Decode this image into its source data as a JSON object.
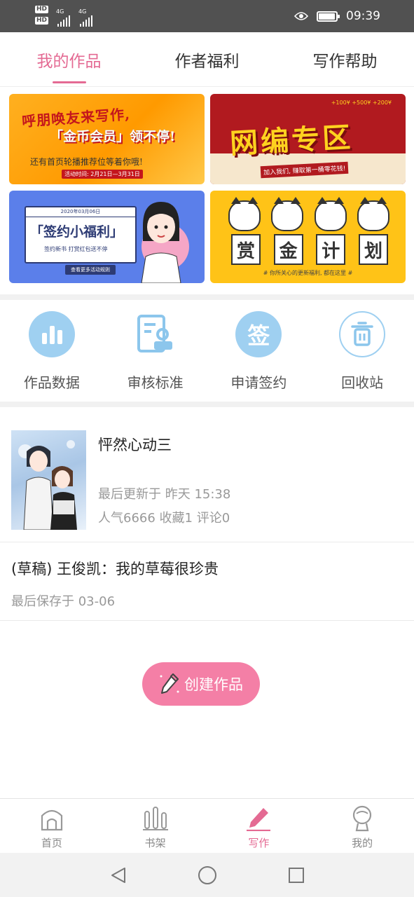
{
  "status_bar": {
    "time": "09:39",
    "network_1": "4G",
    "network_2": "4G",
    "hd": "HD",
    "battery_level": 0.95
  },
  "tabs": [
    {
      "label": "我的作品",
      "active": true
    },
    {
      "label": "作者福利",
      "active": false
    },
    {
      "label": "写作帮助",
      "active": false
    }
  ],
  "banners": {
    "b1": {
      "title": "呼朋唤友来写作,",
      "highlight": "「金币会员」领不停!",
      "sub": "还有首页轮播推荐位等着你哦!",
      "date": "活动时间: 2月21日—3月31日"
    },
    "b2": {
      "title": "网编专区",
      "sub": "加入我们, 赚取第一桶零花钱!",
      "coins": "+100¥  +500¥  +200¥"
    },
    "b3": {
      "window_date": "2020年03月06日",
      "title": "「签约小福利」",
      "sub": "签约新书  打赏红包送不停",
      "button": "查看更多活动规则"
    },
    "b4": {
      "chars": [
        "赏",
        "金",
        "计",
        "划"
      ],
      "sub": "# 你所关心的更新福利, 都在这里 #"
    }
  },
  "actions": [
    {
      "label": "作品数据",
      "icon": "bar-chart-icon",
      "color": "#9fd0f1"
    },
    {
      "label": "审核标准",
      "icon": "document-stamp-icon",
      "color": "#9fd0f1"
    },
    {
      "label": "申请签约",
      "icon": "sign-badge-icon",
      "glyph": "签",
      "color": "#9fd0f1"
    },
    {
      "label": "回收站",
      "icon": "trash-icon",
      "color": "#9fd0f1"
    }
  ],
  "works": [
    {
      "title": "怦然心动三",
      "updated": "最后更新于 昨天 15:38",
      "stats": "人气6666  收藏1  评论0"
    },
    {
      "title": "(草稿) 王俊凯：我的草莓很珍贵",
      "saved": "最后保存于 03-06"
    }
  ],
  "create_button": {
    "label": "创建作品",
    "color": "#f47fa6"
  },
  "bottom_nav": [
    {
      "label": "首页",
      "icon": "home-icon",
      "active": false
    },
    {
      "label": "书架",
      "icon": "bookshelf-icon",
      "active": false
    },
    {
      "label": "写作",
      "icon": "pencil-icon",
      "active": true
    },
    {
      "label": "我的",
      "icon": "profile-icon",
      "active": false
    }
  ],
  "accent_color": "#e46a93"
}
